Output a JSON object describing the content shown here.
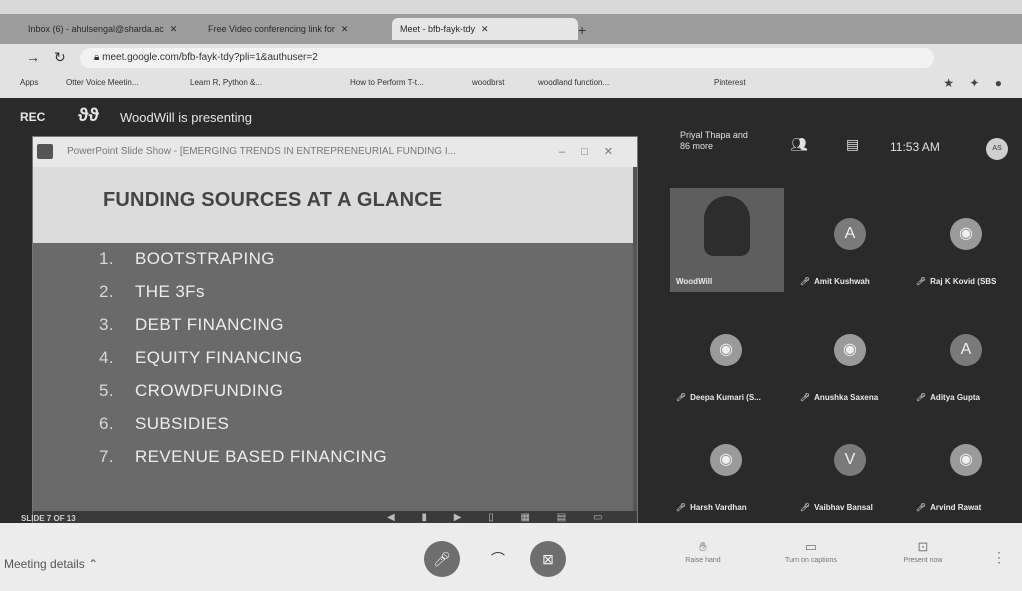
{
  "browser": {
    "tabs": [
      {
        "label": "Inbox (6) - ahulsengal@sharda.ac"
      },
      {
        "label": "Free Video conferencing link for"
      },
      {
        "label": "Meet - bfb-fayk-tdy"
      }
    ],
    "url": "meet.google.com/bfb-fayk-tdy?pli=1&authuser=2",
    "bookmarks": [
      "Apps",
      "Otter Voice Meetin...",
      "Learn R, Python &...",
      "How to Perform T-t...",
      "woodbrst",
      "woodland function...",
      "Pinterest"
    ]
  },
  "meet": {
    "rec_label": "REC",
    "presenting_text": "WoodWill is presenting",
    "participants_summary": "Priyal Thapa and 86 more",
    "time": "11:53 AM"
  },
  "slideshow": {
    "window_title": "PowerPoint Slide Show - [EMERGING TRENDS IN ENTREPRENEURIAL FUNDING I...",
    "slide_title": "FUNDING SOURCES AT A GLANCE",
    "items": [
      {
        "num": "1.",
        "text": "BOOTSTRAPING"
      },
      {
        "num": "2.",
        "text": "THE 3Fs"
      },
      {
        "num": "3.",
        "text": "DEBT FINANCING"
      },
      {
        "num": "4.",
        "text": "EQUITY FINANCING"
      },
      {
        "num": "5.",
        "text": "CROWDFUNDING"
      },
      {
        "num": "6.",
        "text": "SUBSIDIES"
      },
      {
        "num": "7.",
        "text": "REVENUE BASED FINANCING"
      }
    ],
    "slide_counter": "SLIDE 7 OF 13"
  },
  "participants": [
    {
      "name": "WoodWill",
      "initial": ""
    },
    {
      "name": "Amit Kushwah",
      "initial": "A"
    },
    {
      "name": "Raj K Kovid (SBS",
      "initial": ""
    },
    {
      "name": "Deepa Kumari (S...",
      "initial": ""
    },
    {
      "name": "Anushka Saxena",
      "initial": ""
    },
    {
      "name": "Aditya Gupta",
      "initial": "A"
    },
    {
      "name": "Harsh Vardhan",
      "initial": ""
    },
    {
      "name": "Vaibhav Bansal",
      "initial": "V"
    },
    {
      "name": "Arvind Rawat",
      "initial": ""
    }
  ],
  "bottom": {
    "details": "Meeting details",
    "raise_hand": "Raise hand",
    "captions": "Turn on captions",
    "present": "Present now"
  }
}
